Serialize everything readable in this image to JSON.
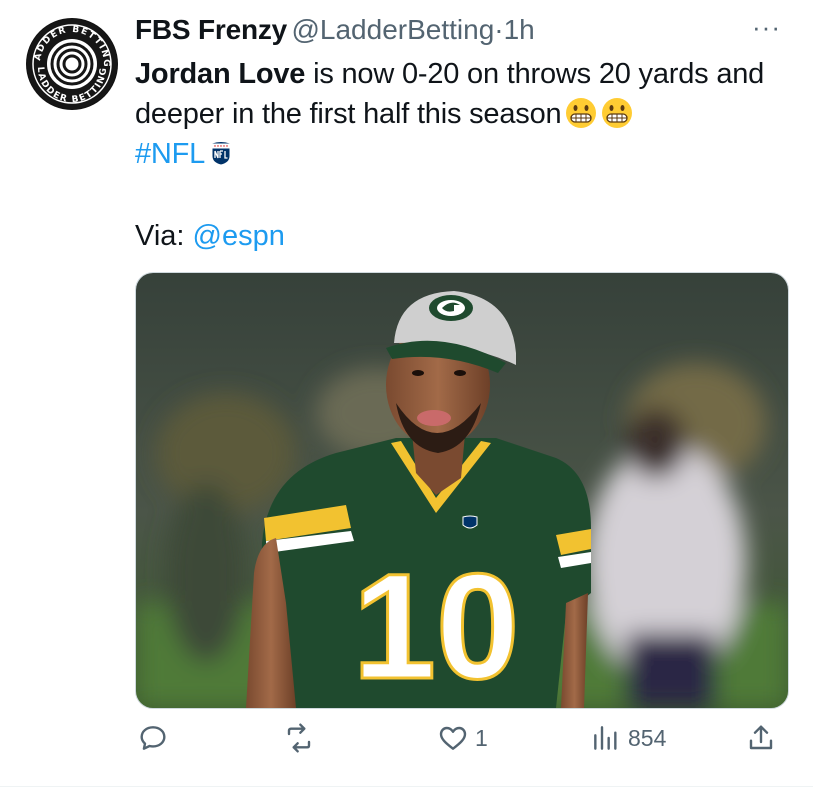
{
  "tweet": {
    "display_name": "FBS Frenzy",
    "handle": "@LadderBetting",
    "separator": "·",
    "time": "1h",
    "text_bold": "Jordan Love",
    "text_rest": " is now 0-20 on throws 20 yards and deeper in the first half this season",
    "hashtag": "#NFL",
    "via_label": "Via: ",
    "via_mention": "@espn",
    "more_label": "···"
  },
  "avatar": {
    "ring_text_top": "LADDER BETTING",
    "ring_text_bottom": "LADDER BETTING"
  },
  "photo": {
    "jersey_number": "10"
  },
  "actions": {
    "reply_count": "",
    "repost_count": "",
    "like_count": "1",
    "views_count": "854"
  },
  "colors": {
    "accent": "#1d9bf0",
    "muted": "#536471",
    "jersey_green": "#1f4a2e",
    "jersey_yellow": "#f2c230"
  },
  "icons": [
    "reply-icon",
    "repost-icon",
    "like-icon",
    "views-icon",
    "share-icon",
    "grimace-emoji-icon",
    "nfl-shield-icon",
    "more-icon"
  ]
}
